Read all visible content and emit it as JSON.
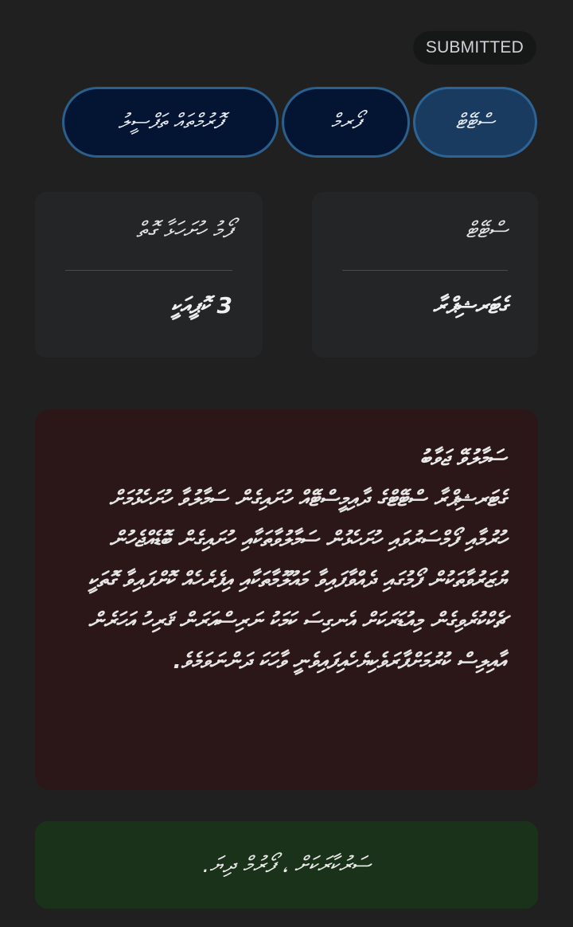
{
  "status": {
    "label": "SUBMITTED"
  },
  "tabs": [
    {
      "label": "ސްޓޭޓް",
      "active": true
    },
    {
      "label": "ފޯރމް",
      "active": false
    },
    {
      "label": "ފޮރުމްތައް ތަފްސީލު",
      "active": false
    }
  ],
  "info": {
    "state": {
      "label": "ސްޓޭޓް",
      "value": "ގެޓަރޝިޕްރާ"
    },
    "forms": {
      "label": "ފޯމު ހުށަހަޅާ ގޮތް",
      "value": "3 ކޮޕީއަކީ"
    }
  },
  "alert": {
    "title": "ސަމާލުވޭ ޖަވާބު",
    "body": "ގެޓަރޝިޕްރާ ސްޓޭޓްގެ ދާއިމީސްޓޭއް ހުށައިގެން ސަމާލުވާ ހުށަހެޅުމަށް ހުރުމާއި ފޯމްސަރުވައި ހުށަހެޅުން ސަމާލުވާތަކާއި ހުށައިގެން ބޮޑެއްޖެހުން ޔުޒަރުވާތަކުން ފޯމުގައި ދެއްވާފައިވާ މައުލޫމާތަކާއި އިފެރެހެއް ކޮށްފައިވާ ގޮތަކީ ޗެކްކުރެވިގެން މިއުޑަރަކަށް އެނގިސަ ކަމަކު ނަރިސްއަރަން ޤަރިހު އަހަރެން އާއިލިސް ކުރުމަށްފާރަވެކިޔެހެއިފައިވެނީ ވާހަކަ ދަންނަވަމެވެ."
  },
  "success": {
    "message": "ސަރުކާރަކަށް ، ފޯރުމް ދިޔަ."
  },
  "colors": {
    "background": "#202020",
    "badge_bg": "#161717",
    "tab_bg": "#041533",
    "tab_active_bg": "#183b5f",
    "tab_border": "#2b5f8c",
    "card_bg": "#242526",
    "alert_bg": "#2b1717",
    "success_bg": "#1a321a"
  }
}
